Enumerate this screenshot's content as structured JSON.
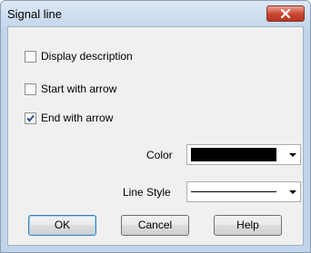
{
  "window": {
    "title": "Signal line"
  },
  "checkboxes": [
    {
      "label": "Display description",
      "checked": false
    },
    {
      "label": "Start with arrow",
      "checked": false
    },
    {
      "label": "End with arrow",
      "checked": true
    }
  ],
  "fields": {
    "color": {
      "label": "Color",
      "value": "#000000"
    },
    "line_style": {
      "label": "Line Style",
      "value": "solid"
    }
  },
  "buttons": {
    "ok": "OK",
    "cancel": "Cancel",
    "help": "Help"
  }
}
